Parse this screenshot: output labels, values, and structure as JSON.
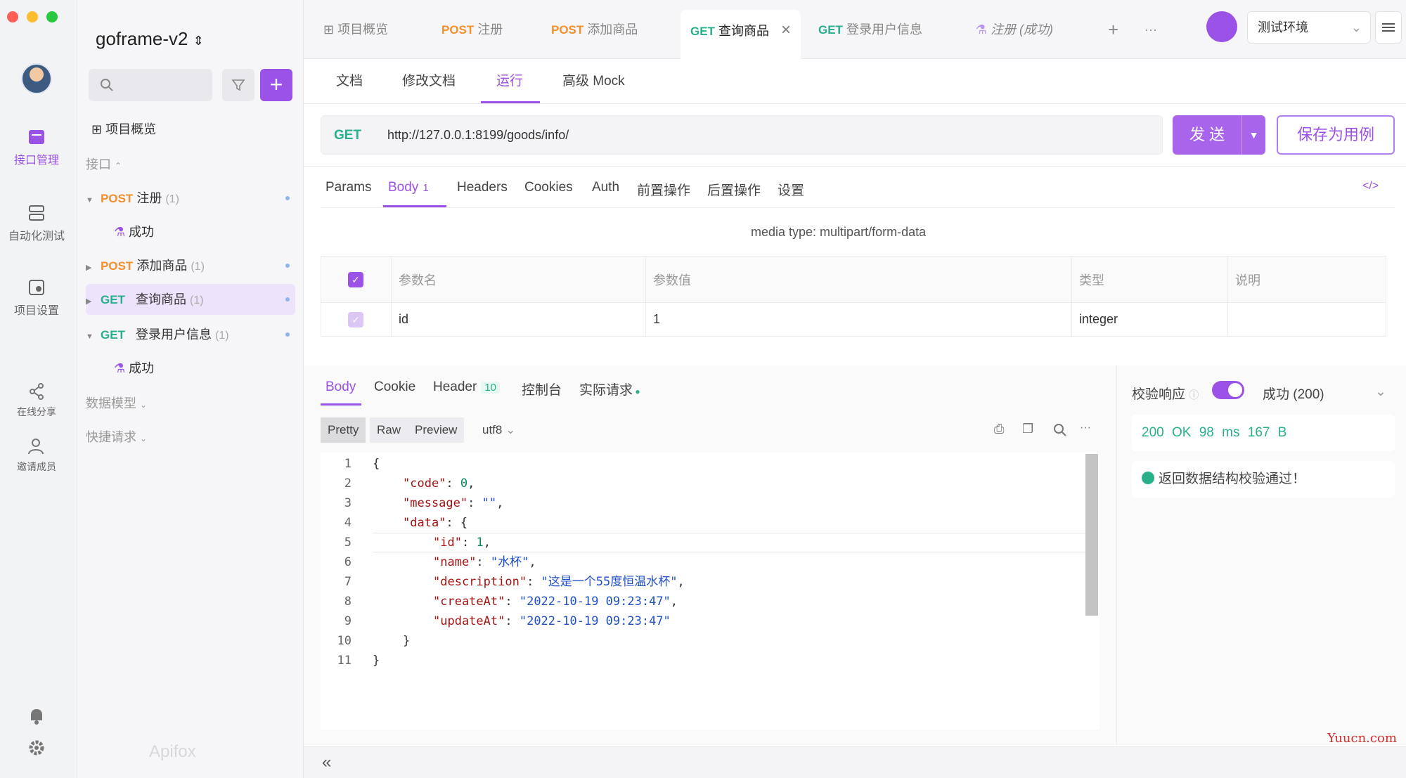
{
  "rail": {
    "items": [
      {
        "label": "接口管理",
        "icon": "api-icon"
      },
      {
        "label": "自动化测试",
        "icon": "automation-icon"
      },
      {
        "label": "项目设置",
        "icon": "settings-icon"
      },
      {
        "label": "在线分享",
        "icon": "share-icon"
      },
      {
        "label": "邀请成员",
        "icon": "invite-icon"
      }
    ]
  },
  "sidebar": {
    "project": "goframe-v2",
    "overview": "项目概览",
    "section_api": "接口",
    "tree": [
      {
        "method": "POST",
        "name": "注册",
        "count": "(1)"
      },
      {
        "name": "成功"
      },
      {
        "method": "POST",
        "name": "添加商品",
        "count": "(1)"
      },
      {
        "method": "GET",
        "name": "查询商品",
        "count": "(1)"
      },
      {
        "method": "GET",
        "name": "登录用户信息",
        "count": "(1)"
      },
      {
        "name": "成功"
      }
    ],
    "data_model": "数据模型",
    "quick_request": "快捷请求",
    "brand": "Apifox"
  },
  "tabs": [
    {
      "method": "",
      "label": "项目概览"
    },
    {
      "method": "POST",
      "label": "注册"
    },
    {
      "method": "POST",
      "label": "添加商品"
    },
    {
      "method": "GET",
      "label": "查询商品"
    },
    {
      "method": "GET",
      "label": "登录用户信息"
    },
    {
      "method": "",
      "label": "注册 (成功)"
    }
  ],
  "environment": "测试环境",
  "doc_tabs": [
    "文档",
    "修改文档",
    "运行",
    "高级 Mock"
  ],
  "request": {
    "method": "GET",
    "url": "http://127.0.0.1:8199/goods/info/",
    "send_label": "发 送",
    "save_label": "保存为用例"
  },
  "param_tabs": {
    "params": "Params",
    "body": "Body",
    "body_count": "1",
    "headers": "Headers",
    "cookies": "Cookies",
    "auth": "Auth",
    "pre": "前置操作",
    "post": "后置操作",
    "settings": "设置"
  },
  "media_type": "media type: multipart/form-data",
  "params_table": {
    "headers": [
      "参数名",
      "参数值",
      "类型",
      "说明"
    ],
    "rows": [
      {
        "name": "id",
        "value": "1",
        "type": "integer",
        "desc": ""
      }
    ]
  },
  "response_tabs": {
    "body": "Body",
    "cookie": "Cookie",
    "header": "Header",
    "header_count": "10",
    "console": "控制台",
    "actual": "实际请求"
  },
  "formats": [
    "Pretty",
    "Raw",
    "Preview"
  ],
  "encoding": "utf8",
  "code_lines": [
    {
      "n": "1",
      "indent": 0,
      "parts": [
        [
          "p",
          "{"
        ]
      ]
    },
    {
      "n": "2",
      "indent": 1,
      "parts": [
        [
          "k",
          "\"code\""
        ],
        [
          "p",
          ": "
        ],
        [
          "n",
          "0"
        ],
        [
          "p",
          ","
        ]
      ]
    },
    {
      "n": "3",
      "indent": 1,
      "parts": [
        [
          "k",
          "\"message\""
        ],
        [
          "p",
          ": "
        ],
        [
          "s",
          "\"\""
        ],
        [
          "p",
          ","
        ]
      ]
    },
    {
      "n": "4",
      "indent": 1,
      "parts": [
        [
          "k",
          "\"data\""
        ],
        [
          "p",
          ": {"
        ]
      ]
    },
    {
      "n": "5",
      "indent": 2,
      "parts": [
        [
          "k",
          "\"id\""
        ],
        [
          "p",
          ": "
        ],
        [
          "n",
          "1"
        ],
        [
          "p",
          ","
        ]
      ]
    },
    {
      "n": "6",
      "indent": 2,
      "parts": [
        [
          "k",
          "\"name\""
        ],
        [
          "p",
          ": "
        ],
        [
          "s",
          "\"水杯\""
        ],
        [
          "p",
          ","
        ]
      ]
    },
    {
      "n": "7",
      "indent": 2,
      "parts": [
        [
          "k",
          "\"description\""
        ],
        [
          "p",
          ": "
        ],
        [
          "s",
          "\"这是一个55度恒温水杯\""
        ],
        [
          "p",
          ","
        ]
      ]
    },
    {
      "n": "8",
      "indent": 2,
      "parts": [
        [
          "k",
          "\"createAt\""
        ],
        [
          "p",
          ": "
        ],
        [
          "s",
          "\"2022-10-19 09:23:47\""
        ],
        [
          "p",
          ","
        ]
      ]
    },
    {
      "n": "9",
      "indent": 2,
      "parts": [
        [
          "k",
          "\"updateAt\""
        ],
        [
          "p",
          ": "
        ],
        [
          "s",
          "\"2022-10-19 09:23:47\""
        ]
      ]
    },
    {
      "n": "10",
      "indent": 1,
      "parts": [
        [
          "p",
          "}"
        ]
      ]
    },
    {
      "n": "11",
      "indent": 0,
      "parts": [
        [
          "p",
          "}"
        ]
      ]
    }
  ],
  "validation": {
    "label": "校验响应",
    "selected": "成功 (200)",
    "status": "200 OK",
    "time": "98 ms",
    "size": "167 B",
    "message": "返回数据结构校验通过！"
  },
  "footer": {
    "collapse": "«"
  },
  "watermark": "Yuucn.com",
  "colors": {
    "accent": "#9b52e6",
    "get": "#27b08b",
    "post": "#f38f2c"
  }
}
